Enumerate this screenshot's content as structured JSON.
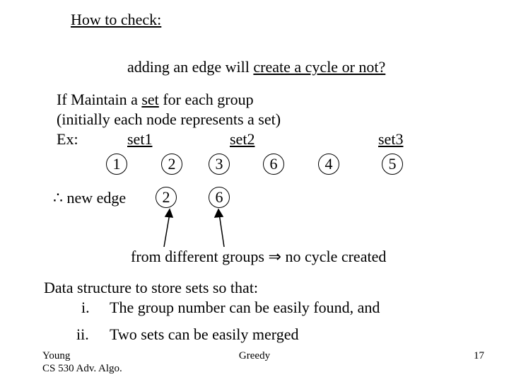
{
  "heading": "How to check:",
  "question": "adding an edge will ",
  "question_ul": "create a cycle or not?",
  "line_if": "If Maintain a ",
  "line_if_ul": "set",
  "line_if2": " for each group",
  "line_initial": "(initially each node represents a set)",
  "ex": "Ex:",
  "set1": "set1",
  "set2": "set2",
  "set3": "set3",
  "nodes": {
    "n1": "1",
    "n2": "2",
    "n3": "3",
    "n6": "6",
    "n4": "4",
    "n5": "5"
  },
  "therefore": "∴",
  "newedge": " new edge",
  "newedge_a": "2",
  "newedge_b": "6",
  "conclusion_pre": "from different groups ",
  "implies": "⇒",
  "conclusion_post": " no cycle created",
  "dsline": "Data structure to store sets so that:",
  "item_i_label": "i.",
  "item_i": "The group number can be easily found, and",
  "item_ii_label": "ii.",
  "item_ii": "Two sets can be easily merged",
  "footer_left1": "Young",
  "footer_left2": "CS 530 Adv. Algo.",
  "footer_center": "Greedy",
  "footer_right": "17"
}
